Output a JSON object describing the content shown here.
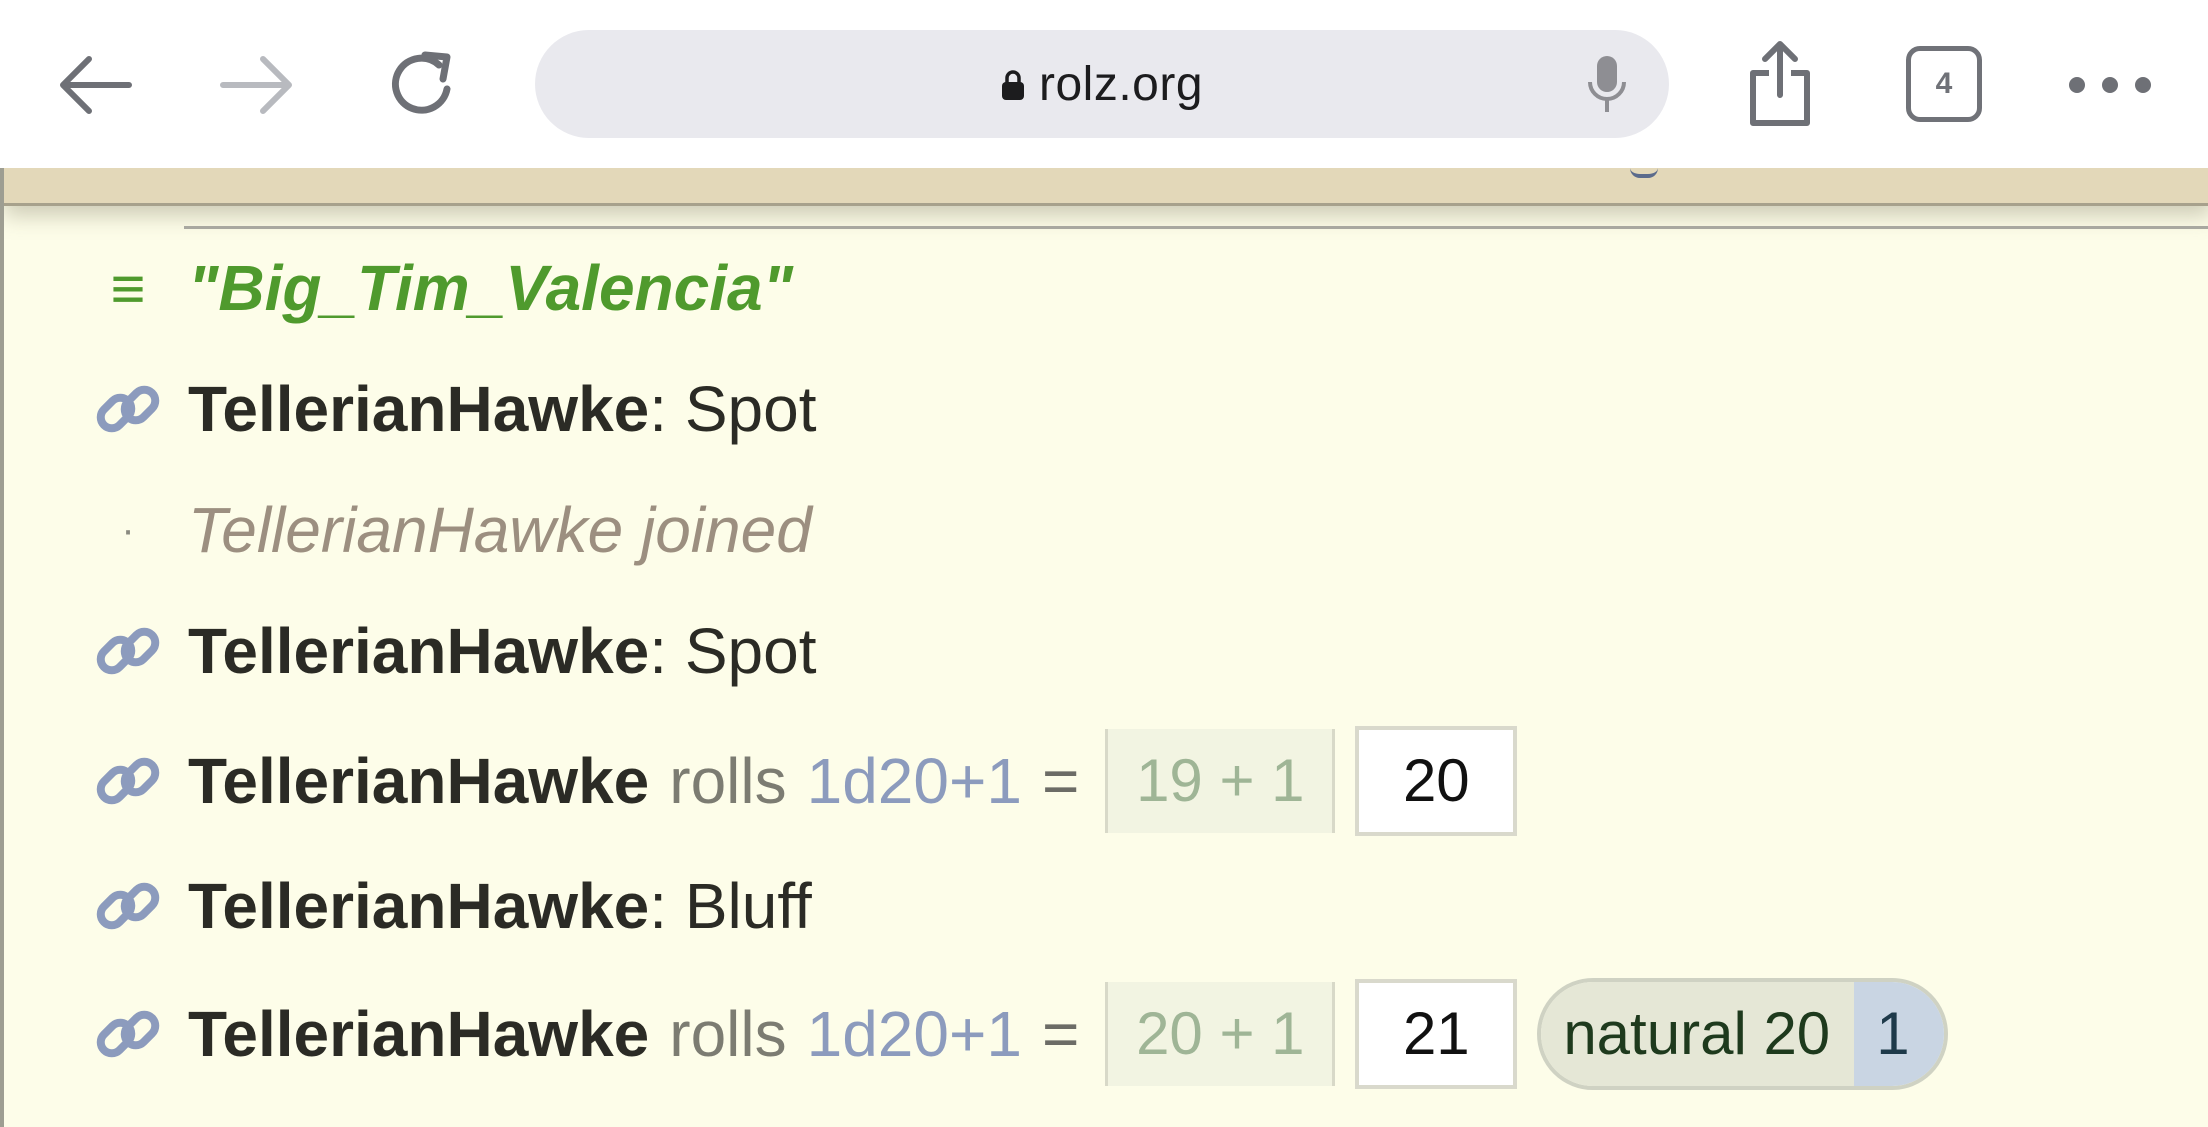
{
  "browser": {
    "url": "rolz.org",
    "tab_count": "4"
  },
  "chat": {
    "topic": "\"Big_Tim_Valencia\"",
    "messages": [
      {
        "type": "message",
        "user": "TellerianHawke",
        "text": ": Spot"
      },
      {
        "type": "event",
        "text": "TellerianHawke joined"
      },
      {
        "type": "message",
        "user": "TellerianHawke",
        "text": ": Spot"
      },
      {
        "type": "roll",
        "user": "TellerianHawke",
        "verb": "rolls",
        "dice": "1d20+1",
        "equals": "=",
        "detail": "19 + 1",
        "result": "20"
      },
      {
        "type": "message",
        "user": "TellerianHawke",
        "text": ": Bluff"
      },
      {
        "type": "roll",
        "user": "TellerianHawke",
        "verb": "rolls",
        "dice": "1d20+1",
        "equals": "=",
        "detail": "20 + 1",
        "result": "21",
        "badge_label": "natural 20",
        "badge_count": "1"
      }
    ]
  },
  "colors": {
    "page_bg": "#fdfde9",
    "topic_green": "#4f9a2d",
    "dice_blue": "#8c9bbd",
    "header_band": "#e3d8b9"
  },
  "icons": {
    "back": "arrow-left-icon",
    "forward": "arrow-right-icon",
    "reload": "reload-icon",
    "lock": "lock-icon",
    "mic": "microphone-icon",
    "share": "share-icon",
    "more": "more-icon",
    "link": "link-icon",
    "menu": "menu-icon"
  }
}
